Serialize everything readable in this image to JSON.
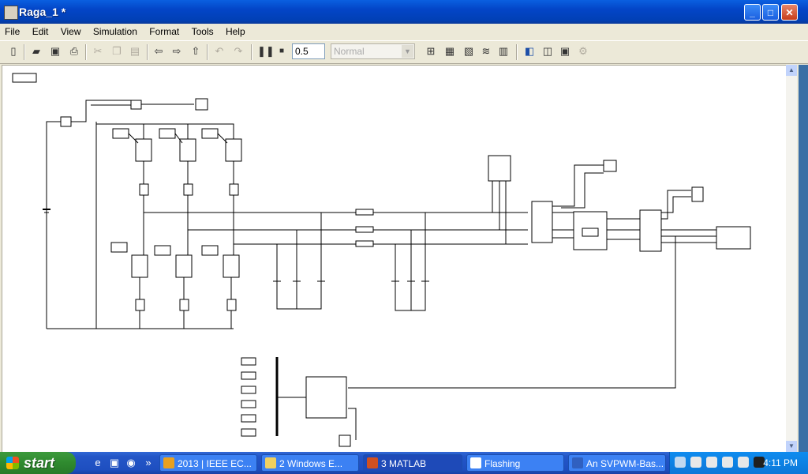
{
  "window": {
    "title": "Raga_1 *"
  },
  "menu": [
    "File",
    "Edit",
    "View",
    "Simulation",
    "Format",
    "Tools",
    "Help"
  ],
  "toolbar": {
    "stop_time": "0.5",
    "sim_mode": "Normal"
  },
  "icons": [
    "new-icon",
    "open-icon",
    "save-icon",
    "print-icon",
    "cut-icon",
    "copy-icon",
    "paste-icon",
    "back-icon",
    "forward-icon",
    "up-icon",
    "undo-icon",
    "redo-icon",
    "pause-icon",
    "stop-icon",
    "library-icon",
    "debugger-icon",
    "model-explorer-icon"
  ],
  "taskbar": {
    "start_label": "start",
    "tasks": [
      {
        "label": "2013 | IEEE EC...",
        "color": "#e8a020"
      },
      {
        "label": "2 Windows E...",
        "color": "#f0d060"
      },
      {
        "label": "3 MATLAB",
        "color": "#d05020"
      },
      {
        "label": "Flashing",
        "color": "#ffffff"
      },
      {
        "label": "An SVPWM-Bas...",
        "color": "#3060c0"
      }
    ],
    "clock": "4:11 PM"
  }
}
